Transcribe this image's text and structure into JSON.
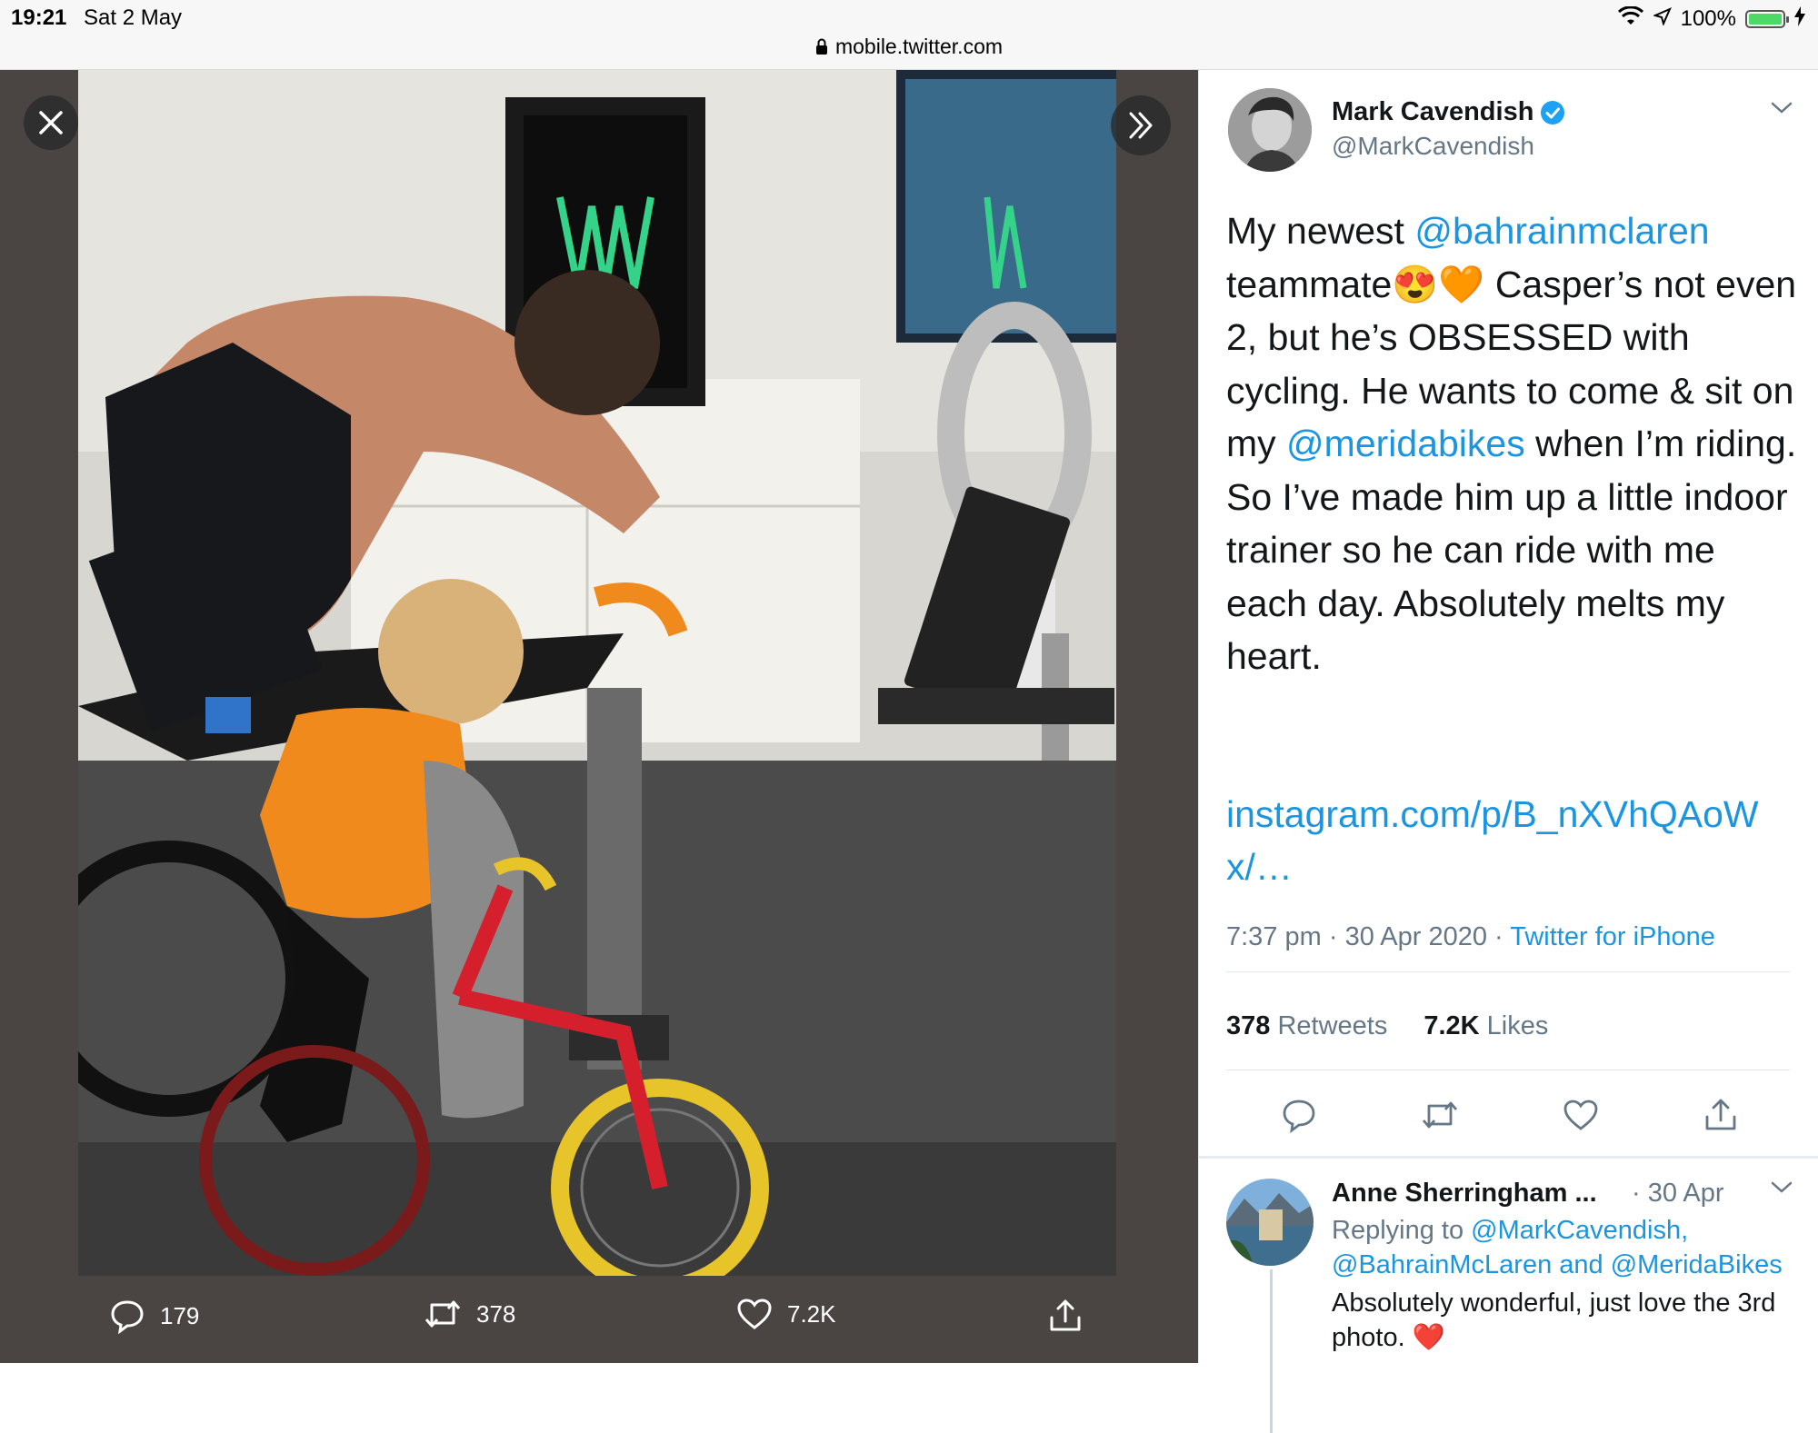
{
  "status_bar": {
    "time": "19:21",
    "date": "Sat 2 May",
    "battery": "100%"
  },
  "url_bar": {
    "url": "mobile.twitter.com"
  },
  "viewer": {
    "actions": {
      "replies": "179",
      "retweets": "378",
      "likes": "7.2K"
    }
  },
  "tweet": {
    "author": {
      "name": "Mark Cavendish",
      "handle": "@MarkCavendish"
    },
    "text": {
      "p1": "My newest ",
      "mention1": "@bahrainmclaren",
      "p2": " teammate",
      "emoji": "😍🧡",
      "p3": " Casper’s not even 2, but he’s OBSESSED with cycling. He wants to come & sit on my ",
      "mention2": "@meridabikes",
      "p4": " when I’m riding. So I’ve made him up a little indoor trainer so he can ride with me each day. Absolutely melts my heart."
    },
    "link": "instagram.com/p/B_nXVhQAoWx/…",
    "time": "7:37 pm",
    "date": "30 Apr 2020",
    "source": "Twitter for iPhone",
    "retweets_count": "378",
    "retweets_label": "Retweets",
    "likes_count": "7.2K",
    "likes_label": "Likes"
  },
  "reply": {
    "name": "Anne Sherringham ...",
    "date": "· 30 Apr",
    "replying_prefix": "Replying to ",
    "replying_to": "@MarkCavendish, @BahrainMcLaren and @MeridaBikes",
    "text": "Absolutely wonderful,  just love the 3rd photo.",
    "emoji": "❤️"
  },
  "colors": {
    "link": "#1b95e0",
    "secondary": "#657786",
    "viewer_bg": "#4a4543",
    "verified": "#1da1f2"
  }
}
